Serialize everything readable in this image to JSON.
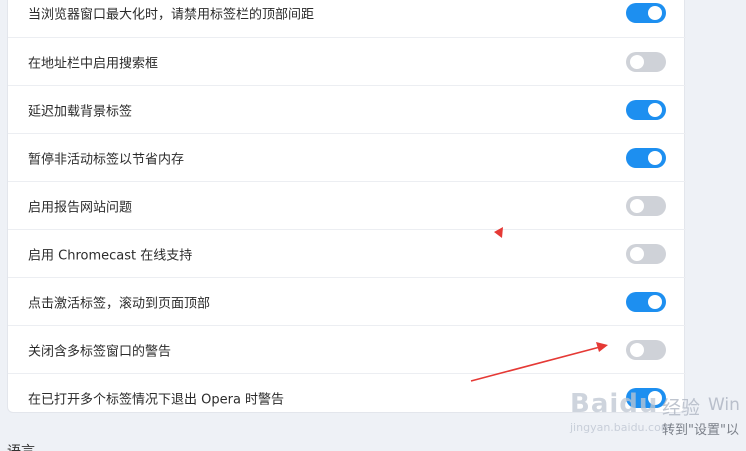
{
  "settings": [
    {
      "label": "当浏览器窗口最大化时，请禁用标签栏的顶部间距",
      "enabled": true
    },
    {
      "label": "在地址栏中启用搜索框",
      "enabled": false
    },
    {
      "label": "延迟加载背景标签",
      "enabled": true
    },
    {
      "label": "暂停非活动标签以节省内存",
      "enabled": true
    },
    {
      "label": "启用报告网站问题",
      "enabled": false
    },
    {
      "label": "启用 Chromecast 在线支持",
      "enabled": false
    },
    {
      "label": "点击激活标签，滚动到页面顶部",
      "enabled": true
    },
    {
      "label": "关闭含多标签窗口的警告",
      "enabled": false
    },
    {
      "label": "在已打开多个标签情况下退出 Opera 时警告",
      "enabled": true
    }
  ],
  "next_section": {
    "heading": "语言"
  },
  "watermark": {
    "logo": "Baidu",
    "logo_cn": "经验",
    "overlay_text": "Win",
    "url": "jingyan.baidu.com",
    "subtext": "转到\"设置\"以"
  },
  "colors": {
    "toggle_on": "#1d8ff0",
    "toggle_off": "#cfd2d8",
    "annotation": "#e53935"
  }
}
